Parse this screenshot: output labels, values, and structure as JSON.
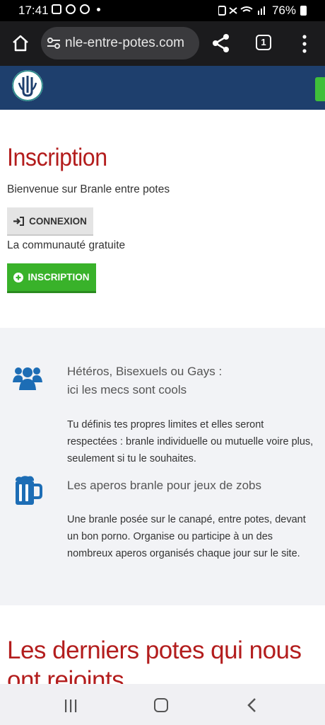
{
  "status_bar": {
    "time": "17:41",
    "battery": "76%"
  },
  "browser": {
    "url": "nle-entre-potes.com",
    "tab_count": "1"
  },
  "main": {
    "title": "Inscription",
    "welcome": "Bienvenue sur Branle entre potes",
    "connexion_label": "CONNEXION",
    "community": "La communauté gratuite",
    "inscription_label": "INSCRIPTION"
  },
  "features": [
    {
      "icon": "users-icon",
      "title_line1": "Hétéros, Bisexuels ou Gays :",
      "title_line2": "ici les mecs sont cools",
      "body": "Tu définis tes propres limites et elles seront respectées : branle individuelle ou mutuelle voire plus, seulement si tu le souhaites."
    },
    {
      "icon": "beer-mug-icon",
      "title_line1": "Les aperos branle pour jeux de zobs",
      "body": "Une branle posée sur le canapé, entre potes, devant un bon porno. Organise ou participe à un des nombreux aperos organisés chaque jour sur le site."
    }
  ],
  "latest": {
    "title": "Les derniers potes qui nous ont rejoints"
  },
  "colors": {
    "accent_red": "#b31d1d",
    "header_blue": "#1e3f6d",
    "green": "#39b22a",
    "icon_blue": "#1d6db5"
  }
}
